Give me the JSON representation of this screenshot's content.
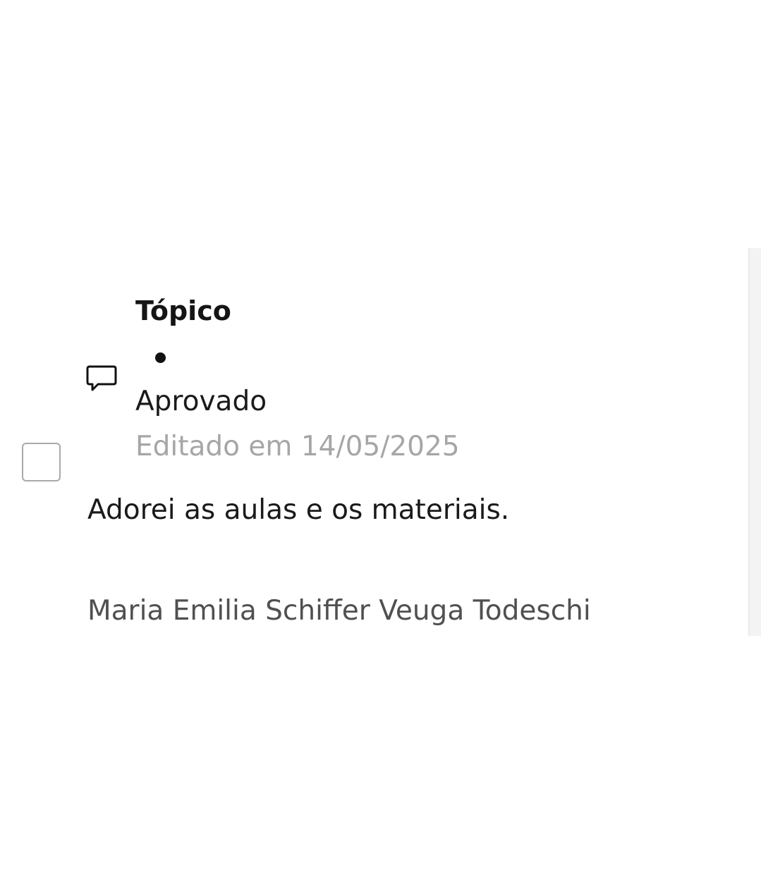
{
  "comment": {
    "topic_label": "Tópico",
    "status": "Aprovado",
    "edited_text": "Editado em 14/05/2025",
    "body": "Adorei as aulas e os materiais.",
    "author": "Maria Emilia Schiffer Veuga Todeschi"
  },
  "icons": {
    "comment": "speech-bubble-icon",
    "bullet": "dot-separator"
  },
  "colors": {
    "primary_text": "#1a1a1a",
    "muted_text": "#a6a6a6",
    "author_text": "#505050",
    "checkbox_border": "#a9a9a9"
  }
}
